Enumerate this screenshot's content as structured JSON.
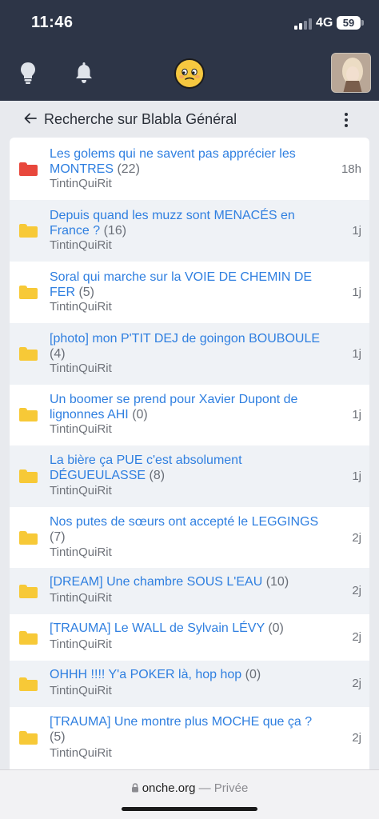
{
  "status_bar": {
    "time": "11:46",
    "network": "4G",
    "battery": "59"
  },
  "header": {
    "icons": [
      "lightbulb-icon",
      "bell-icon",
      "mascot-logo-icon",
      "user-avatar"
    ],
    "colors": {
      "background": "#2d3547",
      "mascot": "#f6c840"
    }
  },
  "page": {
    "title": "Recherche sur Blabla Général"
  },
  "topics": [
    {
      "title": "Les golems qui ne savent pas apprécier les MONTRES",
      "count": "(22)",
      "author": "TintinQuiRit",
      "time": "18h",
      "folder": "red"
    },
    {
      "title": "Depuis quand les muzz sont MENACÉS en France ?",
      "count": "(16)",
      "author": "TintinQuiRit",
      "time": "1j",
      "folder": "yellow"
    },
    {
      "title": "Soral qui marche sur la VOIE DE CHEMIN DE FER",
      "count": "(5)",
      "author": "TintinQuiRit",
      "time": "1j",
      "folder": "yellow"
    },
    {
      "title": "[photo] mon P'TIT DEJ de goingon BOUBOULE",
      "count": "(4)",
      "author": "TintinQuiRit",
      "time": "1j",
      "folder": "yellow"
    },
    {
      "title": "Un boomer se prend pour Xavier Dupont de lignonnes AHI",
      "count": "(0)",
      "author": "TintinQuiRit",
      "time": "1j",
      "folder": "yellow"
    },
    {
      "title": "La bière ça PUE c'est absolument DÉGUEULASSE",
      "count": "(8)",
      "author": "TintinQuiRit",
      "time": "1j",
      "folder": "yellow"
    },
    {
      "title": "Nos putes de sœurs ont accepté le LEGGINGS",
      "count": "(7)",
      "author": "TintinQuiRit",
      "time": "2j",
      "folder": "yellow"
    },
    {
      "title": "[DREAM] Une chambre SOUS L'EAU",
      "count": "(10)",
      "author": "TintinQuiRit",
      "time": "2j",
      "folder": "yellow"
    },
    {
      "title": "[TRAUMA] Le WALL de Sylvain LÉVY",
      "count": "(0)",
      "author": "TintinQuiRit",
      "time": "2j",
      "folder": "yellow"
    },
    {
      "title": "OHHH !!!! Y'a POKER là, hop hop",
      "count": "(0)",
      "author": "TintinQuiRit",
      "time": "2j",
      "folder": "yellow"
    },
    {
      "title": "[TRAUMA] Une montre plus MOCHE que ça ?",
      "count": "(5)",
      "author": "TintinQuiRit",
      "time": "2j",
      "folder": "yellow"
    }
  ],
  "folder_colors": {
    "red": "#e8473c",
    "yellow": "#f7c937"
  },
  "browser": {
    "domain": "onche.org",
    "separator": "—",
    "privacy": "Privée"
  }
}
